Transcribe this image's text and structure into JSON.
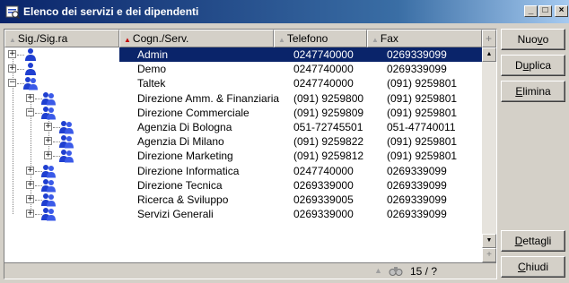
{
  "window": {
    "title": "Elenco dei servizi e dei dipendenti",
    "minimize_label": "_",
    "maximize_label": "□",
    "close_label": "×"
  },
  "columns": [
    {
      "label": "Sig./Sig.ra",
      "sort": "none"
    },
    {
      "label": "Cogn./Serv.",
      "sort": "active"
    },
    {
      "label": "Telefono",
      "sort": "none"
    },
    {
      "label": "Fax",
      "sort": "none"
    }
  ],
  "column_picker_label": "+",
  "rows": [
    {
      "level": 0,
      "expander": "+",
      "icon": "person-icon",
      "name": "Admin",
      "tel": "0247740000",
      "fax": "0269339099",
      "selected": true
    },
    {
      "level": 0,
      "expander": "+",
      "icon": "person-icon",
      "name": "Demo",
      "tel": "0247740000",
      "fax": "0269339099",
      "selected": false
    },
    {
      "level": 0,
      "expander": "−",
      "icon": "group-icon",
      "name": "Taltek",
      "tel": "0247740000",
      "fax": "(091) 9259801",
      "selected": false
    },
    {
      "level": 1,
      "expander": "+",
      "icon": "group-icon",
      "name": "Direzione Amm. & Finanziaria",
      "tel": "(091) 9259800",
      "fax": "(091) 9259801",
      "selected": false
    },
    {
      "level": 1,
      "expander": "−",
      "icon": "group-icon",
      "name": "Direzione Commerciale",
      "tel": "(091) 9259809",
      "fax": "(091) 9259801",
      "selected": false
    },
    {
      "level": 2,
      "expander": "+",
      "icon": "group-icon",
      "name": "Agenzia Di Bologna",
      "tel": "051-72745501",
      "fax": "051-47740011",
      "selected": false
    },
    {
      "level": 2,
      "expander": "+",
      "icon": "group-icon",
      "name": "Agenzia Di Milano",
      "tel": "(091) 9259822",
      "fax": "(091) 9259801",
      "selected": false
    },
    {
      "level": 2,
      "expander": "+",
      "icon": "group-icon",
      "name": "Direzione Marketing",
      "tel": "(091) 9259812",
      "fax": "(091) 9259801",
      "selected": false
    },
    {
      "level": 1,
      "expander": "+",
      "icon": "group-icon",
      "name": "Direzione Informatica",
      "tel": "0247740000",
      "fax": "0269339099",
      "selected": false
    },
    {
      "level": 1,
      "expander": "+",
      "icon": "group-icon",
      "name": "Direzione Tecnica",
      "tel": "0269339000",
      "fax": "0269339099",
      "selected": false
    },
    {
      "level": 1,
      "expander": "+",
      "icon": "group-icon",
      "name": "Ricerca & Sviluppo",
      "tel": "0269339005",
      "fax": "0269339099",
      "selected": false
    },
    {
      "level": 1,
      "expander": "+",
      "icon": "group-icon",
      "name": "Servizi Generali",
      "tel": "0269339000",
      "fax": "0269339099",
      "selected": false
    }
  ],
  "status": {
    "counter": "15 / ?"
  },
  "buttons": {
    "nuovo": {
      "pre": "Nuo",
      "u": "v",
      "post": "o"
    },
    "duplica": {
      "pre": "D",
      "u": "u",
      "post": "plica"
    },
    "elimina": {
      "pre": "",
      "u": "E",
      "post": "limina"
    },
    "dettagli": {
      "pre": "",
      "u": "D",
      "post": "ettagli"
    },
    "chiudi": {
      "pre": "",
      "u": "C",
      "post": "hiudi"
    }
  },
  "colors": {
    "title_gradient_start": "#0a246a",
    "title_gradient_end": "#a6caf0",
    "selection": "#0a246a",
    "chrome": "#d4d0c8",
    "sort_active": "#c00000",
    "icon_blue": "#1f3fd0"
  }
}
